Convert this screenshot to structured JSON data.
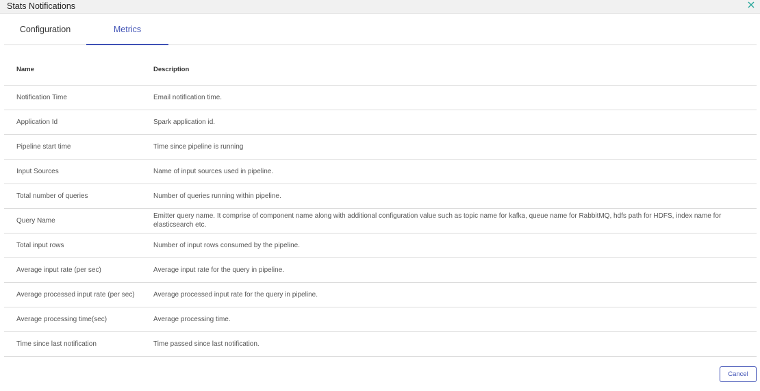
{
  "dialog": {
    "title": "Stats Notifications",
    "close_icon": "close-icon",
    "accent_color": "#3f51b5"
  },
  "tabs": [
    {
      "label": "Configuration",
      "active": false
    },
    {
      "label": "Metrics",
      "active": true
    }
  ],
  "table": {
    "headers": {
      "name": "Name",
      "description": "Description"
    },
    "rows": [
      {
        "name": "Notification Time",
        "description": "Email notification time."
      },
      {
        "name": "Application Id",
        "description": "Spark application id."
      },
      {
        "name": "Pipeline start time",
        "description": "Time since pipeline is running"
      },
      {
        "name": "Input Sources",
        "description": "Name of input sources used in pipeline."
      },
      {
        "name": "Total number of queries",
        "description": "Number of queries running within pipeline."
      },
      {
        "name": "Query Name",
        "description": "Emitter query name. It comprise of component name along with additional configuration value such as topic name for kafka, queue name for RabbitMQ, hdfs path for HDFS, index name for elasticsearch etc."
      },
      {
        "name": "Total input rows",
        "description": "Number of input rows consumed by the pipeline."
      },
      {
        "name": "Average input rate (per sec)",
        "description": "Average input rate for the query in pipeline."
      },
      {
        "name": "Average processed input rate (per sec)",
        "description": "Average processed input rate for the query in pipeline."
      },
      {
        "name": "Average processing time(sec)",
        "description": "Average processing time."
      },
      {
        "name": "Time since last notification",
        "description": "Time passed since last notification."
      }
    ]
  },
  "footer": {
    "cancel_label": "Cancel"
  }
}
